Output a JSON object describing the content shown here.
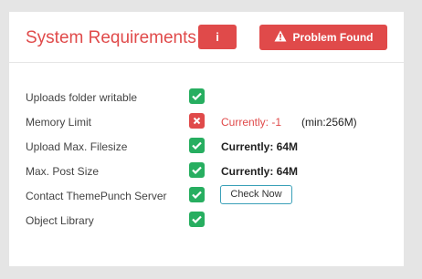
{
  "header": {
    "title": "System Requirements",
    "info_label": "i",
    "problem_label": "Problem Found"
  },
  "requirements": [
    {
      "label": "Uploads folder writable",
      "status": "ok"
    },
    {
      "label": "Memory Limit",
      "status": "fail",
      "value": "Currently: -1",
      "min": "(min:256M)"
    },
    {
      "label": "Upload Max. Filesize",
      "status": "ok",
      "value": "Currently: 64M"
    },
    {
      "label": "Max. Post Size",
      "status": "ok",
      "value": "Currently: 64M"
    },
    {
      "label": "Contact ThemePunch Server",
      "status": "ok",
      "button": "Check Now"
    },
    {
      "label": "Object Library",
      "status": "ok"
    }
  ],
  "colors": {
    "accent": "#e04a4a",
    "ok": "#27ae60",
    "check_border": "#3aa0b8"
  },
  "icons": {
    "ok": "checkmark-icon",
    "fail": "x-icon",
    "warning": "warning-icon"
  }
}
